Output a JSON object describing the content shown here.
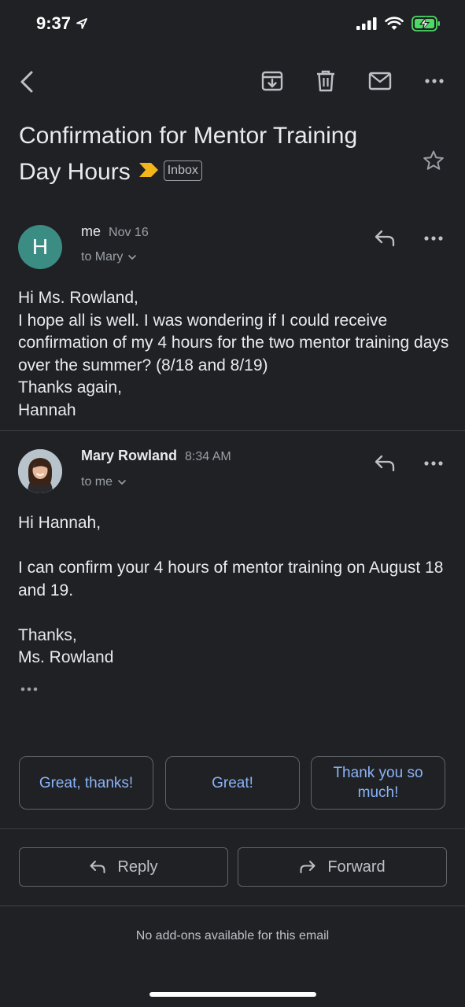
{
  "status_bar": {
    "time": "9:37"
  },
  "email": {
    "subject": "Confirmation for Mentor Training Day Hours",
    "label": "Inbox"
  },
  "messages": [
    {
      "avatar_letter": "H",
      "avatar_color": "#3b8d84",
      "sender": "me",
      "date": "Nov 16",
      "to_line": "to Mary",
      "body": "Hi Ms. Rowland,\nI hope all is well. I was wondering if I could receive confirmation of my 4 hours for the two mentor training days over the summer? (8/18 and 8/19)\nThanks again,\nHannah"
    },
    {
      "sender": "Mary Rowland",
      "date": "8:34 AM",
      "to_line": "to me",
      "body": "Hi Hannah,\n\nI can confirm your 4 hours of mentor training on August 18 and 19.\n\nThanks,\nMs. Rowland"
    }
  ],
  "smart_replies": [
    "Great, thanks!",
    "Great!",
    "Thank you so much!"
  ],
  "actions": {
    "reply": "Reply",
    "forward": "Forward"
  },
  "footer": {
    "addons_text": "No add-ons available for this email"
  },
  "colors": {
    "background": "#202124",
    "link_blue": "#8ab4f8",
    "importance_yellow": "#f2b51c",
    "battery_green": "#4cd964"
  }
}
